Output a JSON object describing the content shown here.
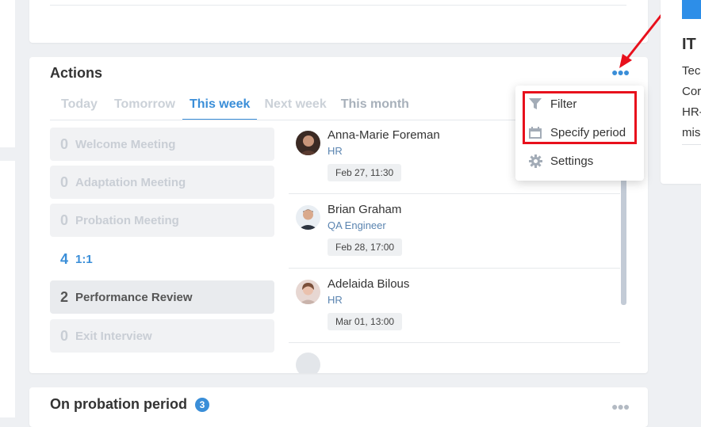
{
  "actions": {
    "title": "Actions",
    "tabs": [
      "Today",
      "Tomorrow",
      "This week",
      "Next week",
      "This month"
    ],
    "categories": [
      {
        "count": "0",
        "label": "Welcome Meeting"
      },
      {
        "count": "0",
        "label": "Adaptation Meeting"
      },
      {
        "count": "0",
        "label": "Probation Meeting"
      },
      {
        "count": "4",
        "label": "1:1"
      },
      {
        "count": "2",
        "label": "Performance Review"
      },
      {
        "count": "0",
        "label": "Exit Interview"
      }
    ],
    "people": [
      {
        "name": "Anna-Marie Foreman",
        "role": "HR",
        "date": "Feb 27, 11:30"
      },
      {
        "name": "Brian Graham",
        "role": "QA Engineer",
        "date": "Feb 28, 17:00"
      },
      {
        "name": "Adelaida Bilous",
        "role": "HR",
        "date": "Mar 01, 13:00"
      }
    ],
    "menu": {
      "filter": "Filter",
      "period": "Specify period",
      "settings": "Settings"
    }
  },
  "probation": {
    "title": "On probation period",
    "badge": "3"
  },
  "right_card": {
    "title": "IT",
    "lines": [
      "Tec",
      "Cor",
      "HR-",
      "mis"
    ]
  },
  "colors": {
    "accent": "#3a8ed8",
    "highlight": "#e8101c"
  },
  "icons": [
    "more-options-icon",
    "filter-icon",
    "calendar-icon",
    "gear-icon",
    "red-arrow-icon"
  ]
}
